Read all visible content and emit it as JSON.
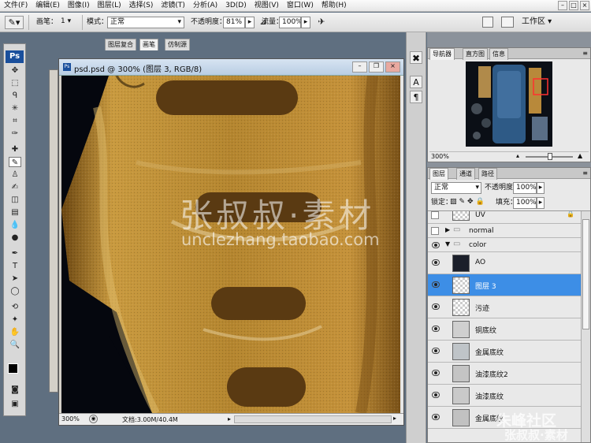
{
  "menubar": {
    "items": [
      "文件(F)",
      "编辑(E)",
      "图像(I)",
      "图层(L)",
      "选择(S)",
      "滤镜(T)",
      "分析(A)",
      "3D(D)",
      "视图(V)",
      "窗口(W)",
      "帮助(H)"
    ]
  },
  "options": {
    "brush_label": "画笔：",
    "brush_size": "1",
    "mode_label": "模式：",
    "mode_value": "正常",
    "opacity_label": "不透明度：",
    "opacity_value": "81%",
    "flow_label": "流量：",
    "flow_value": "100%",
    "workspace_label": "工作区 ▾"
  },
  "panel_tabs": [
    "图层复合",
    "画笔",
    "仿制源"
  ],
  "document": {
    "title": "psd.psd @ 300% (图层 3, RGB/8)",
    "zoom": "300%",
    "doc_info": "文档:3.00M/40.4M"
  },
  "navigator": {
    "tabs": [
      "导航器",
      "直方图",
      "信息"
    ],
    "zoom": "300%"
  },
  "layers": {
    "tabs": [
      "图层",
      "通道",
      "路径"
    ],
    "blend_mode": "正常",
    "opacity_label": "不透明度：",
    "opacity_value": "100%",
    "lock_label": "锁定：",
    "fill_label": "填充：",
    "fill_value": "100%",
    "rows": [
      {
        "name": "UV"
      },
      {
        "name": "normal"
      },
      {
        "name": "color"
      },
      {
        "name": "AO"
      },
      {
        "name": "图层 3"
      },
      {
        "name": "污迹"
      },
      {
        "name": "铜底纹"
      },
      {
        "name": "金属底纹"
      },
      {
        "name": "油漆底纹2"
      },
      {
        "name": "油漆底纹"
      },
      {
        "name": "金属底纹"
      }
    ]
  },
  "watermark": {
    "cn": "张叔叔·素材",
    "url": "unclezhang.taobao.com",
    "corner": "朱峰社区",
    "corner2": "张叔叔·素材"
  },
  "colors": {
    "accent": "#3d8ee6",
    "texture_gold": "#b5862f",
    "texture_dark": "#5a3a12"
  }
}
